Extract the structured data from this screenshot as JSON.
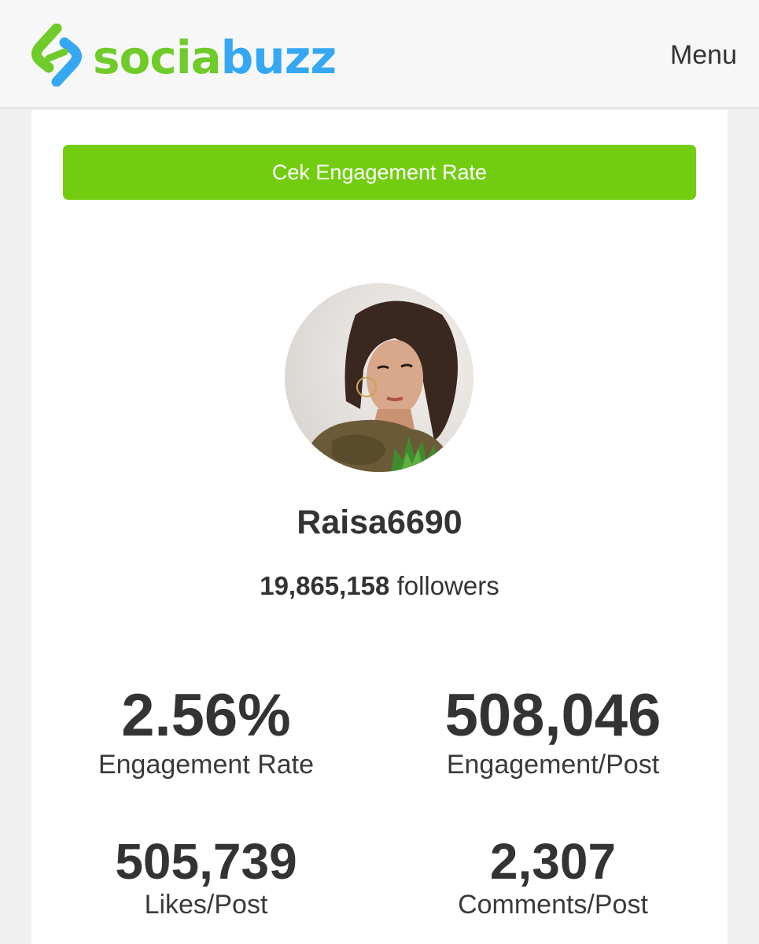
{
  "header": {
    "logo_part1": "socia",
    "logo_part2": "buzz",
    "menu_label": "Menu"
  },
  "cta": {
    "label": "Cek Engagement Rate"
  },
  "profile": {
    "username": "Raisa6690",
    "followers_count": "19,865,158",
    "followers_label": "followers"
  },
  "stats": [
    {
      "value": "2.56%",
      "label": "Engagement Rate"
    },
    {
      "value": "508,046",
      "label": "Engagement/Post"
    },
    {
      "value": "505,739",
      "label": "Likes/Post"
    },
    {
      "value": "2,307",
      "label": "Comments/Post"
    }
  ],
  "colors": {
    "logo_green": "#6fcb2a",
    "logo_blue": "#35a8f3",
    "cta_green": "#72cd11",
    "text": "#333333"
  }
}
